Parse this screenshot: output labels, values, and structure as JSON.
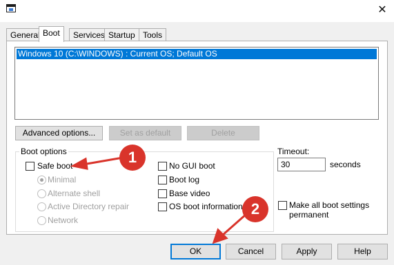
{
  "window": {
    "close_glyph": "✕"
  },
  "tabs": [
    "General",
    "Boot",
    "Services",
    "Startup",
    "Tools"
  ],
  "os_list": [
    "Windows 10 (C:\\WINDOWS) : Current OS; Default OS"
  ],
  "buttons": {
    "advanced": "Advanced options...",
    "set_default": "Set as default",
    "delete": "Delete"
  },
  "boot_options": {
    "title": "Boot options",
    "safe_boot": "Safe boot",
    "minimal": "Minimal",
    "alternate_shell": "Alternate shell",
    "active_directory_repair": "Active Directory repair",
    "network": "Network",
    "no_gui_boot": "No GUI boot",
    "boot_log": "Boot log",
    "base_video": "Base video",
    "os_boot_information": "OS boot information"
  },
  "timeout": {
    "label": "Timeout:",
    "value": "30",
    "unit": "seconds"
  },
  "make_permanent": {
    "line1": "Make all boot settings",
    "line2": "permanent"
  },
  "footer": {
    "ok": "OK",
    "cancel": "Cancel",
    "apply": "Apply",
    "help": "Help"
  },
  "annotations": {
    "badge1": "1",
    "badge2": "2",
    "color": "#d9342b"
  }
}
